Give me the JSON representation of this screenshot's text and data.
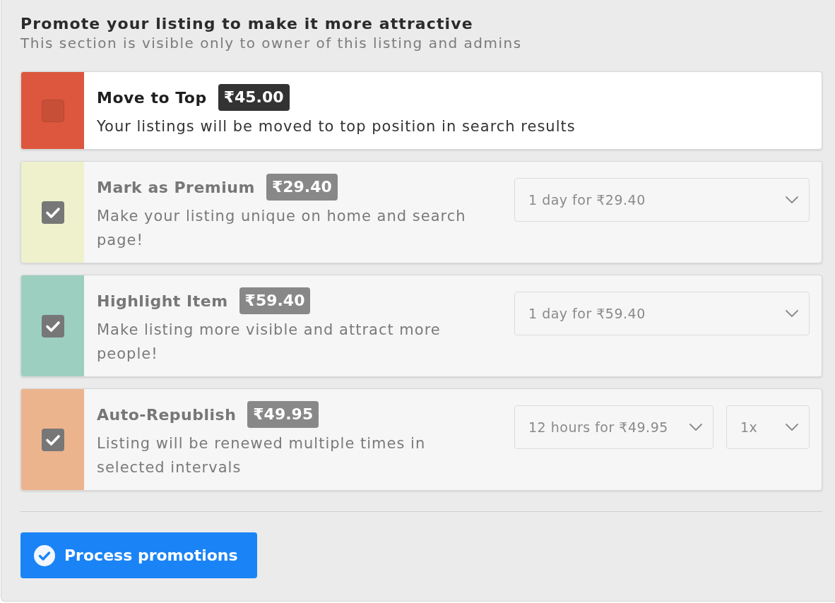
{
  "promotion_panel": {
    "title": "Promote your listing to make it more attractive",
    "subtitle": "This section is visible only to owner of this listing and admins",
    "options": [
      {
        "name": "Move to Top",
        "price": "₹45.00",
        "description": "Your listings will be moved to top position in search results",
        "color": "#dc573d",
        "checked": false
      },
      {
        "name": "Mark as Premium",
        "price": "₹29.40",
        "description": "Make your listing unique on home and search page!",
        "color": "#eef1cc",
        "checked": true,
        "selects": [
          {
            "value": "1 day for ₹29.40"
          }
        ]
      },
      {
        "name": "Highlight Item",
        "price": "₹59.40",
        "description": "Make listing more visible and attract more people!",
        "color": "#9dcfc1",
        "checked": true,
        "selects": [
          {
            "value": "1 day for ₹59.40"
          }
        ]
      },
      {
        "name": "Auto-Republish",
        "price": "₹49.95",
        "description": "Listing will be renewed multiple times in selected intervals",
        "color": "#ecb48c",
        "checked": true,
        "selects": [
          {
            "value": "12 hours for ₹49.95"
          },
          {
            "value": "1x"
          }
        ]
      }
    ],
    "submit_button": {
      "label": "Process promotions"
    }
  }
}
